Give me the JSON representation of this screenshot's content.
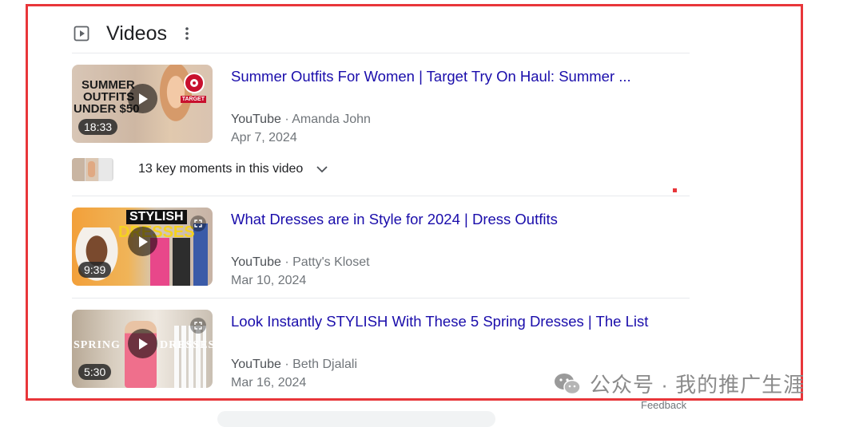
{
  "section": {
    "title": "Videos"
  },
  "videos": [
    {
      "title": "Summer Outfits For Women | Target Try On Haul: Summer ...",
      "source": "YouTube",
      "channel": "Amanda John",
      "date": "Apr 7, 2024",
      "duration": "18:33",
      "thumb_text": [
        "SUMMER",
        "OUTFITS",
        "UNDER $50"
      ],
      "thumb_badge": "TARGET"
    },
    {
      "title": "What Dresses are in Style for 2024 | Dress Outfits",
      "source": "YouTube",
      "channel": "Patty's Kloset",
      "date": "Mar 10, 2024",
      "duration": "9:39",
      "thumb_text": [
        "STYLISH",
        "DRESSES"
      ]
    },
    {
      "title": "Look Instantly STYLISH With These 5 Spring Dresses | The List",
      "source": "YouTube",
      "channel": "Beth Djalali",
      "date": "Mar 16, 2024",
      "duration": "5:30",
      "thumb_text": [
        "SPRING",
        "DRESSES"
      ]
    }
  ],
  "key_moments": {
    "label": "13 key moments in this video"
  },
  "meta_separator": "·",
  "watermark": "公众号 · 我的推广生涯",
  "feedback": "Feedback",
  "icons": {
    "section": "video-play-box-icon",
    "menu": "more-vert-icon",
    "play": "play-icon",
    "expand": "chevron-down-icon",
    "fullscreen": "expand-icon",
    "wechat": "wechat-icon"
  },
  "colors": {
    "link": "#1a0dab",
    "frame": "#e8363a",
    "meta": "#70757a"
  }
}
